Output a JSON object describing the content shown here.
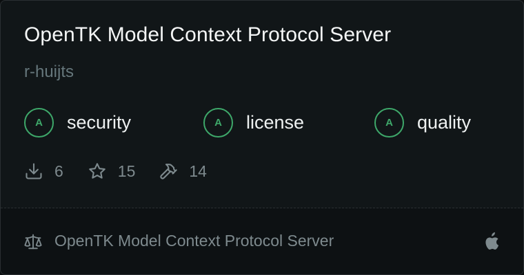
{
  "card": {
    "title": "OpenTK Model Context Protocol Server",
    "author": "r-huijts",
    "grades": [
      {
        "grade": "A",
        "label": "security"
      },
      {
        "grade": "A",
        "label": "license"
      },
      {
        "grade": "A",
        "label": "quality"
      }
    ],
    "stats": {
      "downloads": "6",
      "stars": "15",
      "tools": "14"
    },
    "footer": {
      "license_text": "OpenTK Model Context Protocol Server"
    }
  },
  "icons": {
    "downloads": "download-icon",
    "stars": "star-icon",
    "tools": "hammer-icon",
    "license": "scale-icon",
    "platform": "apple-icon"
  },
  "colors": {
    "background": "#111618",
    "grade_accent": "#3ea86a",
    "title": "#f4f6f6",
    "muted": "#7e8a8e"
  }
}
